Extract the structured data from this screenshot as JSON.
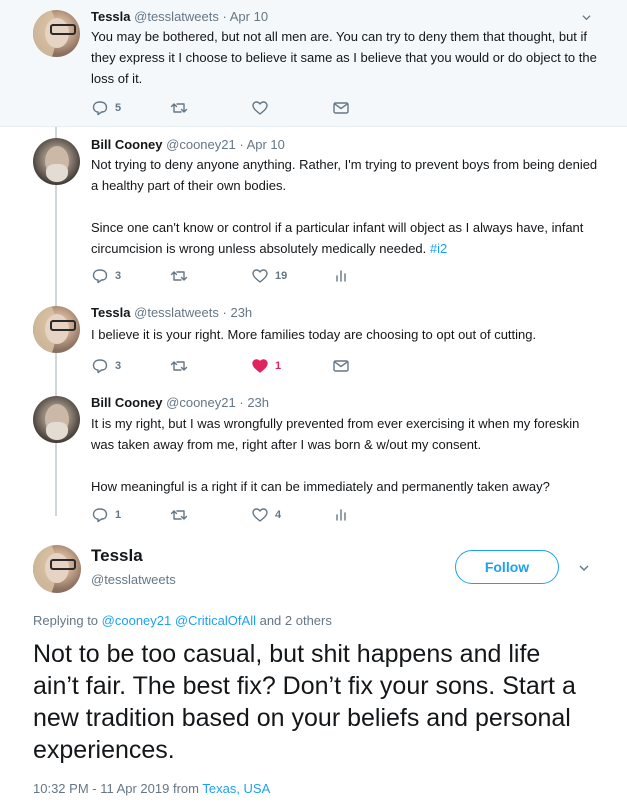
{
  "tweets": [
    {
      "name": "Tessla",
      "handle": "@tesslatweets",
      "sep": "·",
      "date": "Apr 10",
      "text": "You may be bothered, but not all men are. You can try to deny them that thought, but if they express it I choose to believe it same as I believe that you would or do object to the loss of it.",
      "replies": "5"
    },
    {
      "name": "Bill Cooney",
      "handle": "@cooney21",
      "sep": "·",
      "date": "Apr 10",
      "text": "Not trying to deny anyone anything. Rather, I'm trying to prevent boys from being denied a healthy part of their own bodies.\n\nSince one can't know or control if a particular infant will object as I always have, infant circumcision is wrong unless absolutely medically needed.",
      "hashtag": "#i2",
      "replies": "3",
      "likes": "19"
    },
    {
      "name": "Tessla",
      "handle": "@tesslatweets",
      "sep": "·",
      "date": "23h",
      "text": "I believe it is your right. More families today are choosing to opt out of cutting.",
      "replies": "3",
      "likes": "1"
    },
    {
      "name": "Bill Cooney",
      "handle": "@cooney21",
      "sep": "·",
      "date": "23h",
      "text": "It is my right, but I was wrongfully prevented from ever exercising it when my foreskin was taken away from me, right after I was born & w/out my consent.\n\nHow meaningful is a right if it can be immediately and permanently taken away?",
      "replies": "1",
      "likes": "4"
    }
  ],
  "main_tweet": {
    "name": "Tessla",
    "handle": "@tesslatweets",
    "follow_label": "Follow",
    "replying_prefix": "Replying to",
    "reply_to_1": "@cooney21",
    "reply_to_2": "@CriticalOfAll",
    "replying_suffix": "and 2 others",
    "text": "Not to be too casual, but shit happens and life ain’t fair. The best fix? Don’t fix your sons. Start a new tradition based on your beliefs and personal experiences.",
    "time": "10:32 PM - 11 Apr 2019 from",
    "location": "Texas, USA"
  },
  "colors": {
    "accent": "#1da1f2",
    "like": "#e0245e",
    "muted": "#657786"
  },
  "icons": [
    "reply-icon",
    "retweet-icon",
    "like-icon",
    "message-icon",
    "analytics-icon",
    "chevron-down-icon"
  ]
}
